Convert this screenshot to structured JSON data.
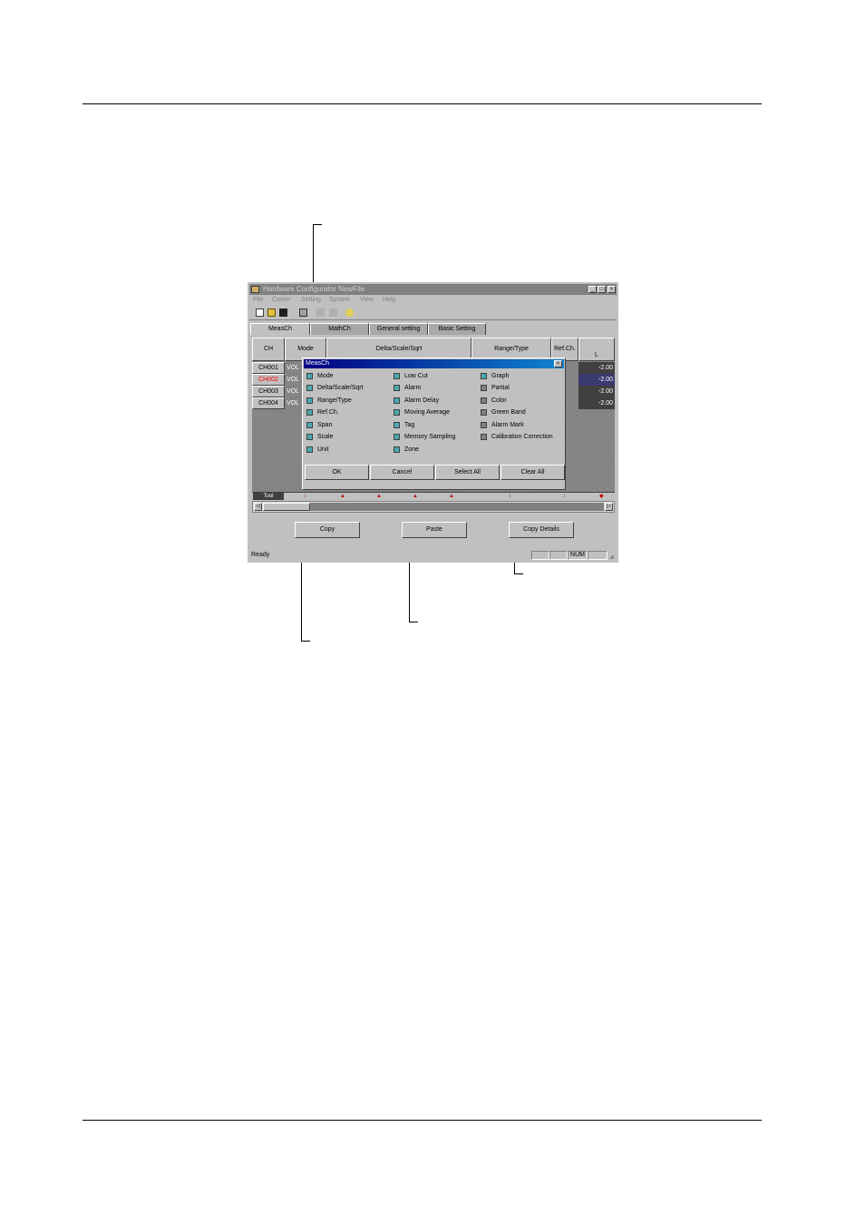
{
  "window": {
    "title": "Hardware Configurator NewFile",
    "minimize_glyph": "_",
    "maximize_glyph": "□",
    "close_glyph": "×",
    "menu": [
      "File",
      "Comm",
      "Setting",
      "System",
      "View",
      "Help"
    ]
  },
  "tabs": [
    "MeasCh",
    "MathCh",
    "General setting",
    "Basic Setting"
  ],
  "grid": {
    "columns": [
      "CH",
      "Mode",
      "Delta/Scale/Sqrt",
      "Range/Type",
      "Ref.Ch.",
      "L"
    ],
    "rows": [
      {
        "ch": "CH001",
        "mode": "VOL",
        "value": "-2.00"
      },
      {
        "ch": "CH002",
        "mode": "VOL",
        "value": "-2.00"
      },
      {
        "ch": "CH003",
        "mode": "VOL",
        "value": "-2.00"
      },
      {
        "ch": "CH004",
        "mode": "VOL",
        "value": "-2.00"
      }
    ],
    "tool_label": "Tool"
  },
  "buttons": {
    "copy": "Copy",
    "paste": "Paste",
    "copy_details": "Copy Details"
  },
  "status": {
    "ready": "Ready",
    "num": "NUM"
  },
  "dialog": {
    "title": "MeasCh",
    "close_glyph": "×",
    "options": [
      {
        "label": "Mode",
        "checked": true
      },
      {
        "label": "Delta/Scale/Sqrt",
        "checked": true
      },
      {
        "label": "Range/Type",
        "checked": true
      },
      {
        "label": "Ref.Ch.",
        "checked": true
      },
      {
        "label": "Span",
        "checked": true
      },
      {
        "label": "Scale",
        "checked": true
      },
      {
        "label": "Unit",
        "checked": true
      },
      {
        "label": "Low Cut",
        "checked": true
      },
      {
        "label": "Alarm",
        "checked": true
      },
      {
        "label": "Alarm Delay",
        "checked": true
      },
      {
        "label": "Moving Average",
        "checked": true
      },
      {
        "label": "Tag",
        "checked": true
      },
      {
        "label": "Memory Sampling",
        "checked": true
      },
      {
        "label": "Zone",
        "checked": true
      },
      {
        "label": "Graph",
        "checked": true
      },
      {
        "label": "Partial",
        "checked": false
      },
      {
        "label": "Color",
        "checked": false
      },
      {
        "label": "Green Band",
        "checked": false
      },
      {
        "label": "Alarm Mark",
        "checked": false
      },
      {
        "label": "Calibration Correction",
        "checked": false
      }
    ],
    "buttons": [
      "OK",
      "Cancel",
      "Select All",
      "Clear All"
    ]
  },
  "colors": {
    "checked": "#4aa8b0",
    "unchecked": "#808080",
    "selected_channel_text": "#ff0000"
  }
}
